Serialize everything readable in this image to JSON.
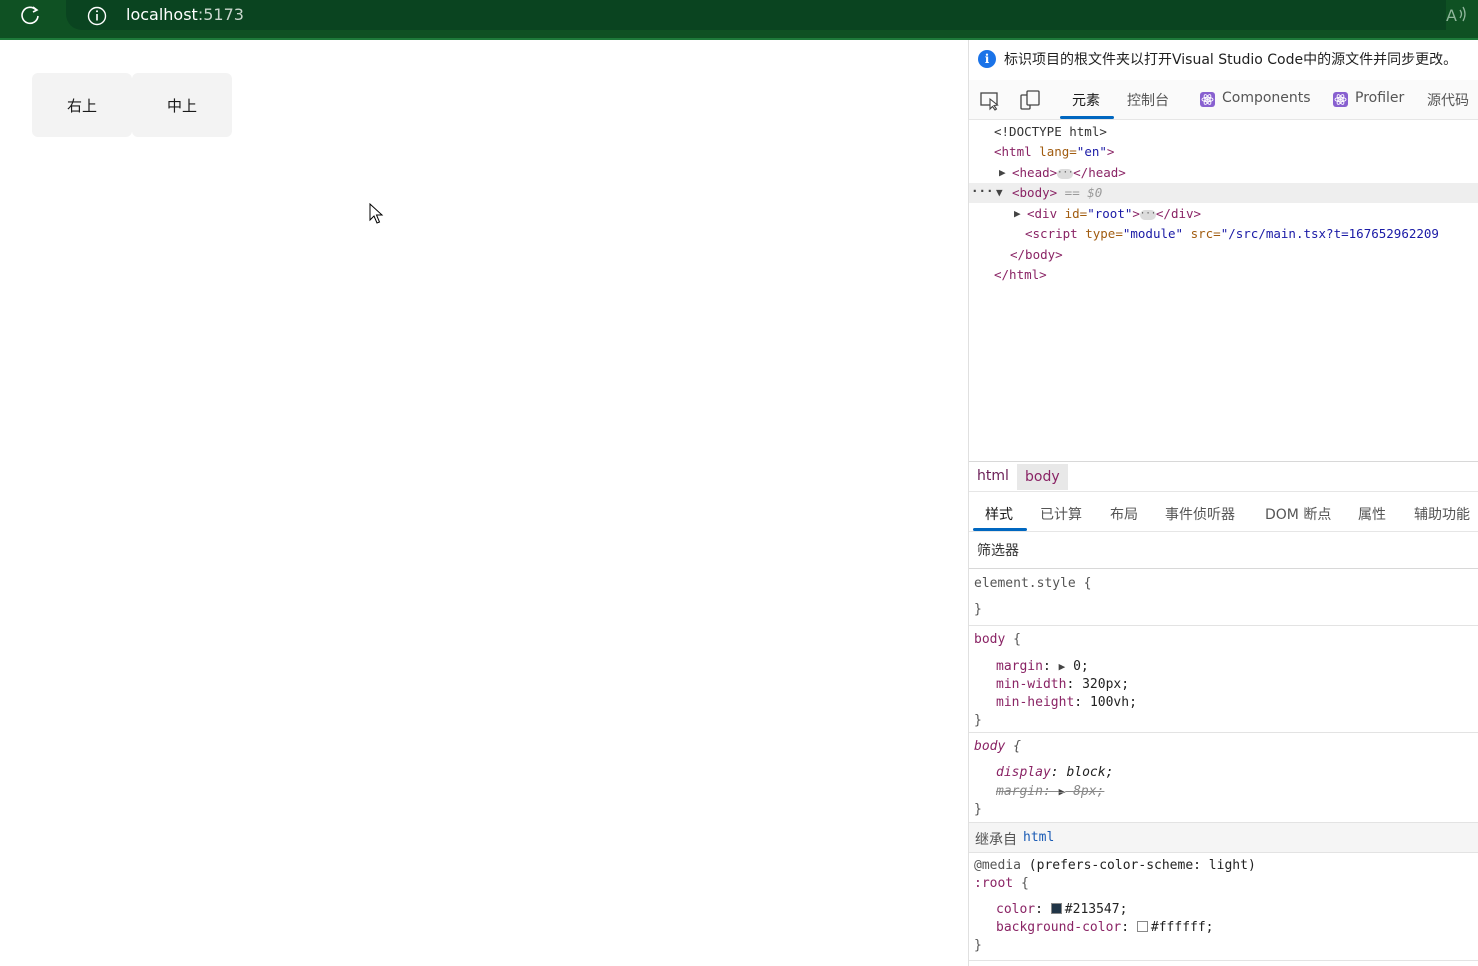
{
  "browser": {
    "url_host": "localhost",
    "url_port": ":5173"
  },
  "page": {
    "buttons": [
      "右上",
      "中上"
    ]
  },
  "devtools": {
    "banner": "标识项目的根文件夹以打开Visual Studio Code中的源文件并同步更改。",
    "tabs": [
      "元素",
      "控制台",
      "Components",
      "Profiler",
      "源代码"
    ],
    "active_tab": "元素",
    "dom": {
      "doctype": "<!DOCTYPE html>",
      "html_open_tag": "<html",
      "html_attr": " lang=",
      "html_attr_val": "\"en\"",
      "head_open": "<head>",
      "head_close": "</head>",
      "body_open": "<body>",
      "body_eq": " == $0",
      "div_open": "<div",
      "div_attr": " id=",
      "div_attr_val": "\"root\"",
      "div_close": "</div>",
      "script_open": "<script",
      "script_attr1": " type=",
      "script_attr1_val": "\"module\"",
      "script_attr2": " src=",
      "script_attr2_val": "\"/src/main.tsx?t=167652962209",
      "body_close": "</body>",
      "html_close": "</html>"
    },
    "breadcrumbs": [
      "html",
      "body"
    ],
    "sub_tabs": [
      "样式",
      "已计算",
      "布局",
      "事件侦听器",
      "DOM 断点",
      "属性",
      "辅助功能"
    ],
    "filter_placeholder": "筛选器",
    "styles": {
      "element_style": "element.style {",
      "close": "}",
      "rule1_selector": "body",
      "rule1_open": " {",
      "rule1_props": [
        {
          "name": "margin",
          "value": "0;"
        },
        {
          "name": "min-width",
          "value": "320px;"
        },
        {
          "name": "min-height",
          "value": "100vh;"
        }
      ],
      "rule2_selector": "body",
      "rule2_props": [
        {
          "name": "display",
          "value": "block;"
        },
        {
          "name": "margin",
          "value": "8px;"
        }
      ],
      "inherited_label": "继承自",
      "inherited_link": "html",
      "media": "@media",
      "media_query": " (prefers-color-scheme: light)",
      "root_selector": ":root",
      "root_props": [
        {
          "name": "color",
          "value": "#213547;",
          "swatch": "#213547"
        },
        {
          "name": "background-color",
          "value": "#ffffff;",
          "swatch": "#ffffff"
        }
      ]
    }
  },
  "colors": {
    "topbar": "#0f5123",
    "accent": "#0067c0"
  }
}
